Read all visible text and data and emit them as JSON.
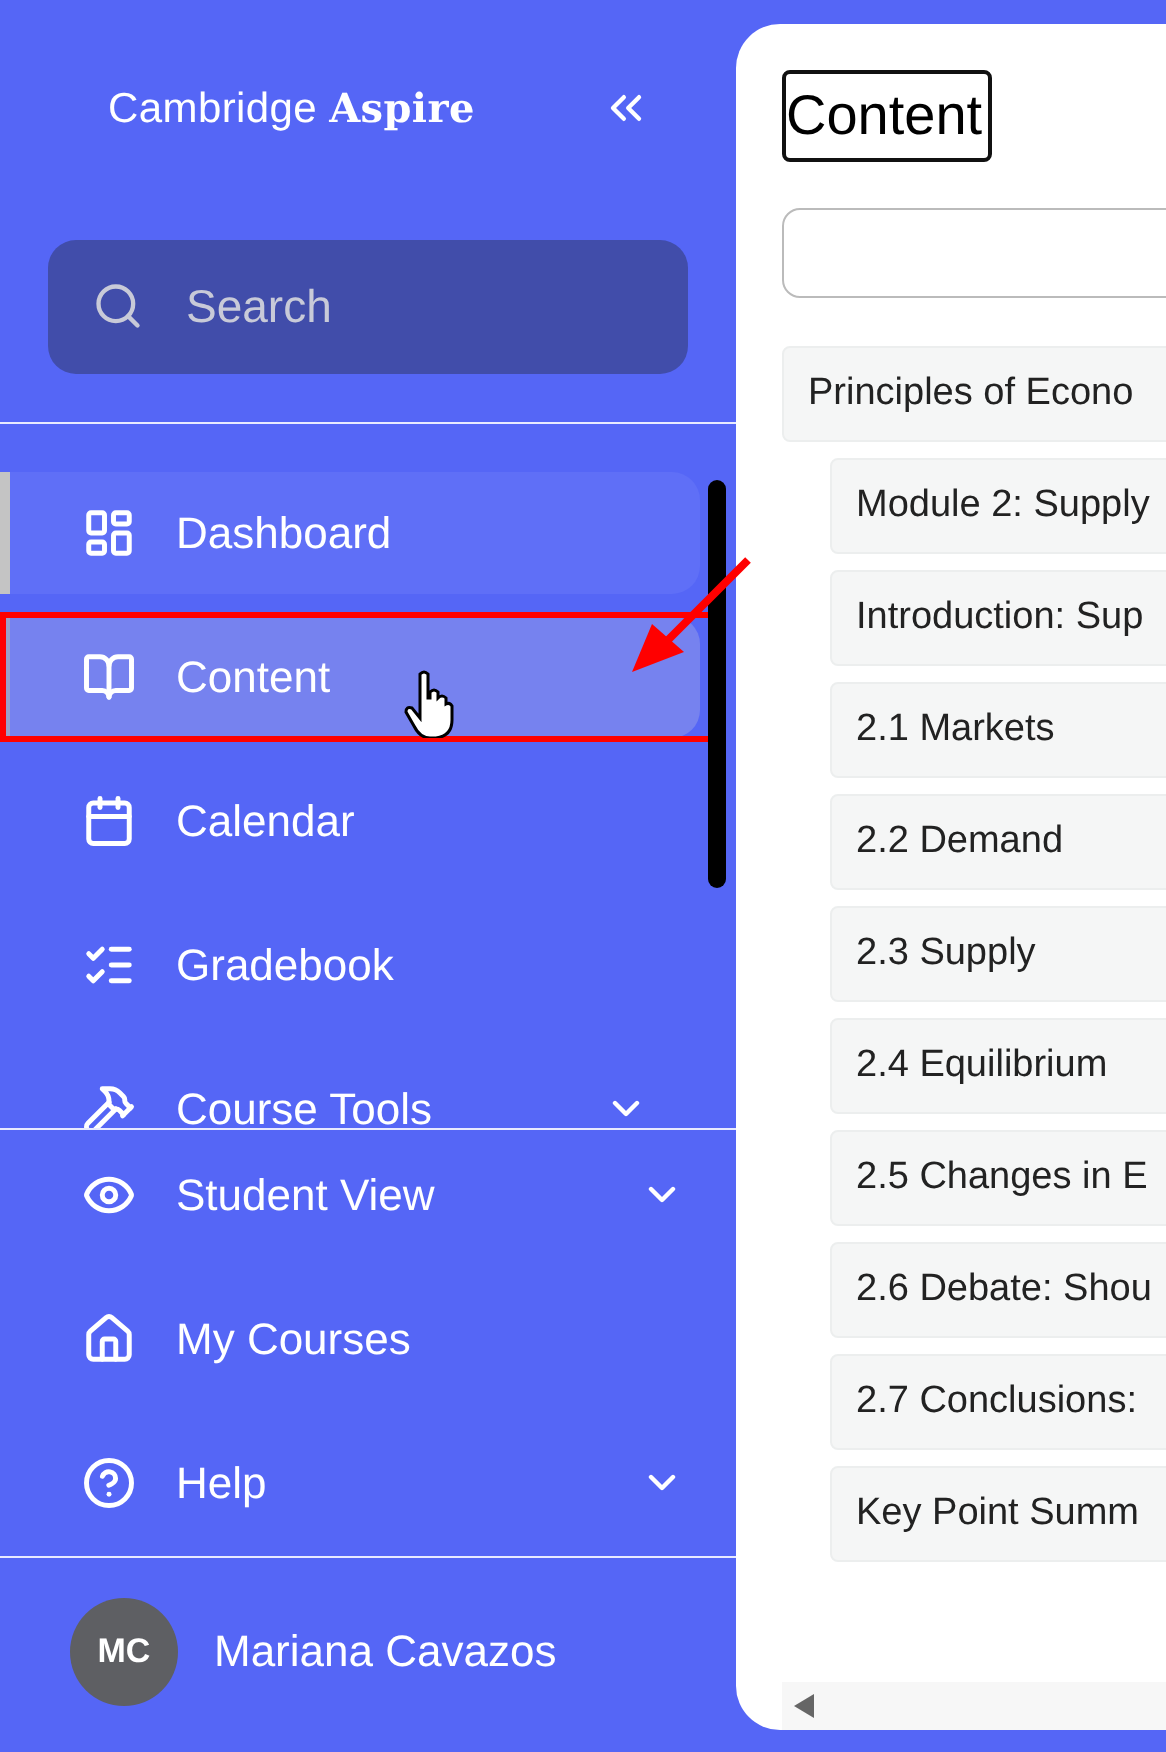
{
  "sidebar": {
    "logo": "Cambridge **Aspire**",
    "search": {
      "placeholder": "Search"
    },
    "nav_items": [
      {
        "kind": "dashboard",
        "label": "Dashboard",
        "selected": true,
        "hovered": false,
        "expandable": false
      },
      {
        "kind": "book",
        "label": "Content",
        "selected": false,
        "hovered": true,
        "expandable": false
      },
      {
        "kind": "calendar",
        "label": "Calendar",
        "selected": false,
        "hovered": false,
        "expandable": false
      },
      {
        "kind": "gradebook",
        "label": "Gradebook",
        "selected": false,
        "hovered": false,
        "expandable": false
      },
      {
        "kind": "tools",
        "label": "Course Tools",
        "selected": false,
        "hovered": false,
        "expandable": true
      }
    ],
    "bottom_items": [
      {
        "kind": "eye",
        "label": "Student View",
        "expandable": true
      },
      {
        "kind": "home",
        "label": "My Courses",
        "expandable": false
      },
      {
        "kind": "help",
        "label": "Help",
        "expandable": true
      }
    ],
    "user": {
      "initials": "MC",
      "name": "Mariana Cavazos"
    }
  },
  "main": {
    "title": "Content",
    "tree": {
      "label": "Principles of Econo",
      "children": [
        {
          "label": "Module 2: Supply"
        },
        {
          "label": "Introduction: Sup"
        },
        {
          "label": "2.1 Markets"
        },
        {
          "label": "2.2 Demand"
        },
        {
          "label": "2.3 Supply"
        },
        {
          "label": "2.4 Equilibrium"
        },
        {
          "label": "2.5 Changes in E"
        },
        {
          "label": "2.6 Debate: Shou"
        },
        {
          "label": "2.7 Conclusions:"
        },
        {
          "label": "Key Point Summ"
        }
      ]
    }
  }
}
